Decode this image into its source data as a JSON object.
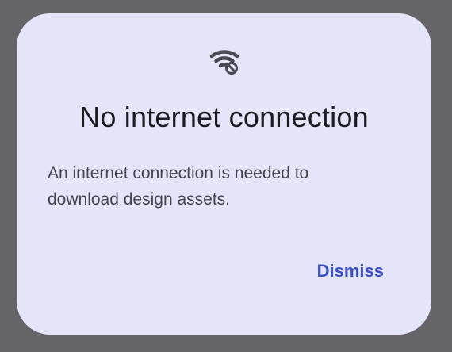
{
  "dialog": {
    "icon": "wifi-off-icon",
    "title": "No internet connection",
    "message": "An internet connection is needed to download design assets.",
    "dismiss_label": "Dismiss"
  },
  "colors": {
    "backdrop": "#656468",
    "dialog_bg": "#e5e5f9",
    "title_text": "#1c1b22",
    "body_text": "#45454f",
    "action_text": "#3a4fc4",
    "icon": "#4a4a54"
  }
}
